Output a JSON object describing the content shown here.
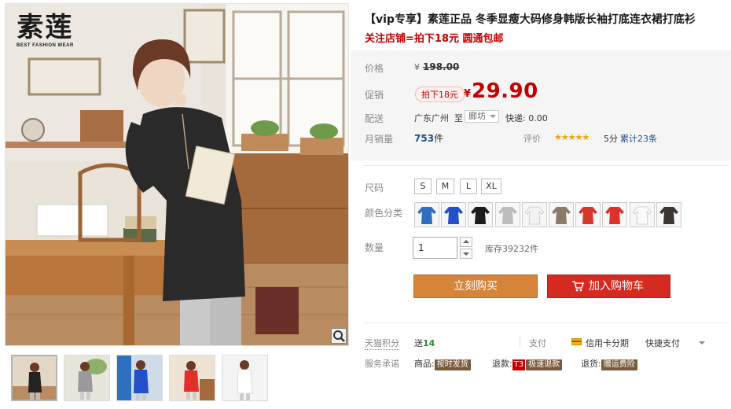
{
  "brand": {
    "name": "素莲",
    "tagline": "BEST FASHION WEAR"
  },
  "product": {
    "title": "【vip专享】素莲正品 冬季显瘦大码修身韩版长袖打底连衣裙打底衫",
    "promo_line": "关注店铺=拍下18元 圆通包邮"
  },
  "pricing": {
    "price_label": "价格",
    "currency": "¥",
    "original_price": "198.00",
    "promo_label": "促销",
    "promo_tag": "拍下18元",
    "promo_price": "29.90"
  },
  "shipping": {
    "label": "配送",
    "from": "广东广州",
    "to_word": "至",
    "destination": "廊坊",
    "express": "快递: 0.00"
  },
  "sales": {
    "label": "月销量",
    "count": "753",
    "unit": "件",
    "rating_label": "评价",
    "stars": "★★★★★",
    "score": "5分",
    "reviews": "累计23条"
  },
  "options": {
    "size_label": "尺码",
    "sizes": [
      "S",
      "M",
      "L",
      "XL"
    ],
    "color_label": "颜色分类",
    "color_swatches": [
      "#2f6fbf",
      "#2350c8",
      "#1c1c1c",
      "#bdbdbd",
      "#f2f2f2",
      "#8a7a6a",
      "#d8352a",
      "#e0302a",
      "#fafafa",
      "#3b3532"
    ],
    "qty_label": "数量",
    "qty_value": "1",
    "stock": "库存39232件"
  },
  "actions": {
    "buy_now": "立刻购买",
    "add_to_cart": "加入购物车"
  },
  "services": {
    "points_label": "天猫积分",
    "points_prefix": "送",
    "points_value": "14",
    "pay_label": "支付",
    "credit_card": "信用卡分期",
    "quick_pay": "快捷支付",
    "promise_label": "服务承诺",
    "goods_label": "商品:",
    "goods_badge": "按时发货",
    "refund_label": "退款:",
    "refund_prefix": "T3",
    "refund_badge": "极速退款",
    "return_label": "退货:",
    "return_badge": "赠运费险"
  },
  "colors": {
    "price_red": "#c40000",
    "buy_orange": "#d7843b",
    "cart_red": "#d52a1f",
    "link_blue": "#1f4e8c",
    "star_gold": "#f0a30a"
  }
}
